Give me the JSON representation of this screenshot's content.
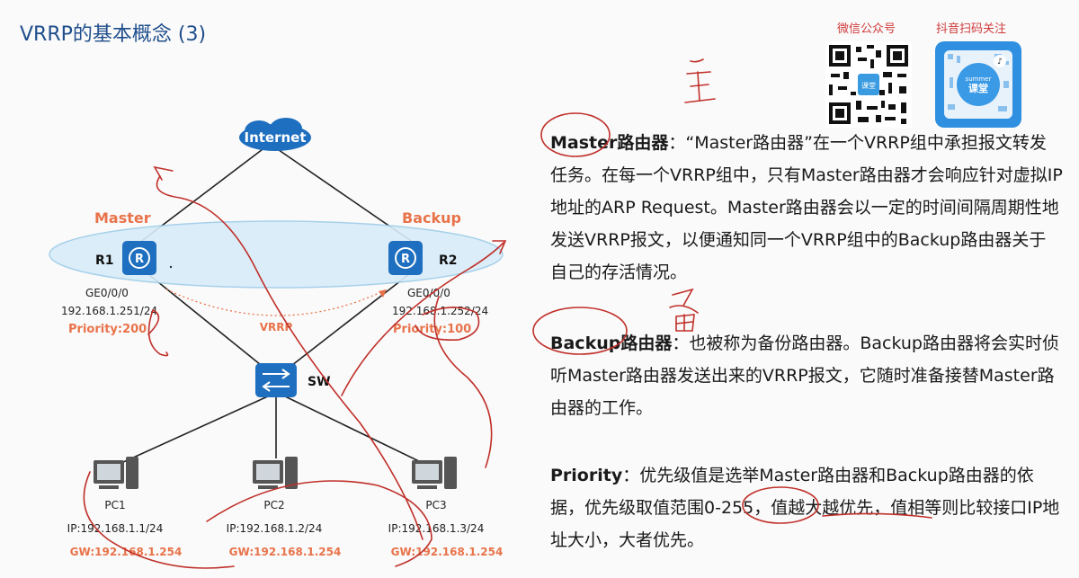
{
  "title": "VRRP的基本概念 (3)",
  "qr": {
    "wechat_label": "微信公众号",
    "douyin_label": "抖音扫码关注",
    "brand_small": "summer",
    "brand_big": "课堂"
  },
  "diagram": {
    "internet": "Internet",
    "master_label": "Master",
    "backup_label": "Backup",
    "r1": "R1",
    "r2": "R2",
    "r1_port": "GE0/0/0",
    "r1_ip": "192.168.1.251/24",
    "r1_priority": "Priority:200",
    "r2_port": "GE0/0/0",
    "r2_ip": "192.168.1.252/24",
    "r2_priority": "Priority:100",
    "vrrp": "VRRP",
    "sw": "SW",
    "pcs": [
      {
        "name": "PC1",
        "ip": "IP:192.168.1.1/24",
        "gw": "GW:192.168.1.254"
      },
      {
        "name": "PC2",
        "ip": "IP:192.168.1.2/24",
        "gw": "GW:192.168.1.254"
      },
      {
        "name": "PC3",
        "ip": "IP:192.168.1.3/24",
        "gw": "GW:192.168.1.254"
      }
    ]
  },
  "text": {
    "master_term": "Master路由器",
    "master_body": "：“Master路由器”在一个VRRP组中承担报文转发任务。在每一个VRRP组中，只有Master路由器才会响应针对虚拟IP地址的ARP Request。Master路由器会以一定的时间间隔周期性地发送VRRP报文，以便通知同一个VRRP组中的Backup路由器关于自己的存活情况。",
    "backup_term": "Backup路由器",
    "backup_body": "：也被称为备份路由器。Backup路由器将会实时侦听Master路由器发送出来的VRRP报文，它随时准备接替Master路由器的工作。",
    "priority_term": "Priority",
    "priority_body": "：优先级值是选举Master路由器和Backup路由器的依据，优先级取值范围0-255，值越大越优先，值相等则比较接口IP地址大小，大者优先。"
  },
  "colors": {
    "title": "#1f4e8c",
    "orange": "#e8734a",
    "router_blue": "#1e6fbf",
    "annotation_red": "#c0302a"
  }
}
